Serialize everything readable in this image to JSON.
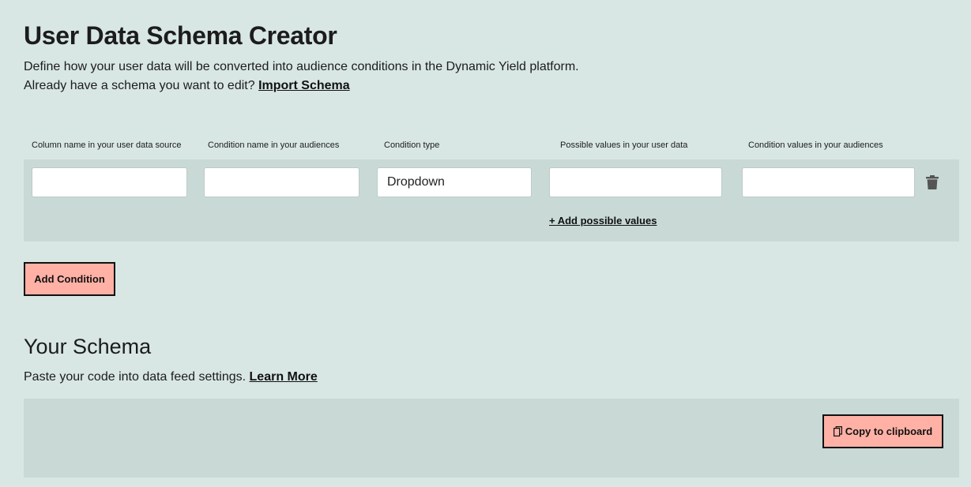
{
  "header": {
    "title": "User Data Schema Creator",
    "description": "Define how your user data will be converted into audience conditions in the Dynamic Yield platform.",
    "import_prompt": "Already have a schema you want to edit?",
    "import_link": "Import Schema"
  },
  "table": {
    "columns": [
      "Column name in your user data source",
      "Condition name in your audiences",
      "Condition type",
      "Possible values in your user data",
      "Condition values in your audiences"
    ],
    "rows": [
      {
        "column_name": "",
        "condition_name": "",
        "condition_type": "Dropdown",
        "possible_values": "",
        "condition_values": "",
        "add_values_link": "+ Add possible values",
        "delete_icon": "trash-icon"
      }
    ]
  },
  "add_condition_label": "Add Condition",
  "schema": {
    "title": "Your Schema",
    "description": "Paste your code into data feed settings.",
    "learn_more": "Learn More",
    "copy_label": "Copy to clipboard",
    "copy_icon": "copy-icon"
  },
  "colors": {
    "background": "#d8e7e4",
    "panel": "#c8d9d6",
    "button": "#ffb1a6"
  }
}
